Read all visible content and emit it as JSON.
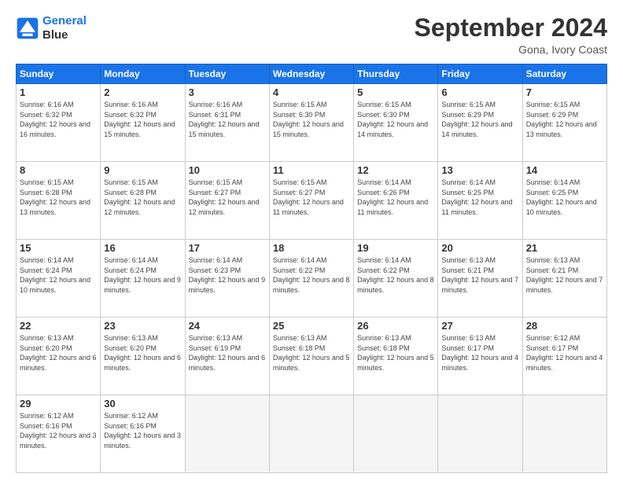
{
  "logo": {
    "line1": "General",
    "line2": "Blue"
  },
  "title": "September 2024",
  "subtitle": "Gona, Ivory Coast",
  "days_header": [
    "Sunday",
    "Monday",
    "Tuesday",
    "Wednesday",
    "Thursday",
    "Friday",
    "Saturday"
  ],
  "weeks": [
    [
      {
        "num": "1",
        "sunrise": "6:16 AM",
        "sunset": "6:32 PM",
        "daylight": "12 hours and 16 minutes."
      },
      {
        "num": "2",
        "sunrise": "6:16 AM",
        "sunset": "6:32 PM",
        "daylight": "12 hours and 15 minutes."
      },
      {
        "num": "3",
        "sunrise": "6:16 AM",
        "sunset": "6:31 PM",
        "daylight": "12 hours and 15 minutes."
      },
      {
        "num": "4",
        "sunrise": "6:15 AM",
        "sunset": "6:30 PM",
        "daylight": "12 hours and 15 minutes."
      },
      {
        "num": "5",
        "sunrise": "6:15 AM",
        "sunset": "6:30 PM",
        "daylight": "12 hours and 14 minutes."
      },
      {
        "num": "6",
        "sunrise": "6:15 AM",
        "sunset": "6:29 PM",
        "daylight": "12 hours and 14 minutes."
      },
      {
        "num": "7",
        "sunrise": "6:15 AM",
        "sunset": "6:29 PM",
        "daylight": "12 hours and 13 minutes."
      }
    ],
    [
      {
        "num": "8",
        "sunrise": "6:15 AM",
        "sunset": "6:28 PM",
        "daylight": "12 hours and 13 minutes."
      },
      {
        "num": "9",
        "sunrise": "6:15 AM",
        "sunset": "6:28 PM",
        "daylight": "12 hours and 12 minutes."
      },
      {
        "num": "10",
        "sunrise": "6:15 AM",
        "sunset": "6:27 PM",
        "daylight": "12 hours and 12 minutes."
      },
      {
        "num": "11",
        "sunrise": "6:15 AM",
        "sunset": "6:27 PM",
        "daylight": "12 hours and 11 minutes."
      },
      {
        "num": "12",
        "sunrise": "6:14 AM",
        "sunset": "6:26 PM",
        "daylight": "12 hours and 11 minutes."
      },
      {
        "num": "13",
        "sunrise": "6:14 AM",
        "sunset": "6:25 PM",
        "daylight": "12 hours and 11 minutes."
      },
      {
        "num": "14",
        "sunrise": "6:14 AM",
        "sunset": "6:25 PM",
        "daylight": "12 hours and 10 minutes."
      }
    ],
    [
      {
        "num": "15",
        "sunrise": "6:14 AM",
        "sunset": "6:24 PM",
        "daylight": "12 hours and 10 minutes."
      },
      {
        "num": "16",
        "sunrise": "6:14 AM",
        "sunset": "6:24 PM",
        "daylight": "12 hours and 9 minutes."
      },
      {
        "num": "17",
        "sunrise": "6:14 AM",
        "sunset": "6:23 PM",
        "daylight": "12 hours and 9 minutes."
      },
      {
        "num": "18",
        "sunrise": "6:14 AM",
        "sunset": "6:22 PM",
        "daylight": "12 hours and 8 minutes."
      },
      {
        "num": "19",
        "sunrise": "6:14 AM",
        "sunset": "6:22 PM",
        "daylight": "12 hours and 8 minutes."
      },
      {
        "num": "20",
        "sunrise": "6:13 AM",
        "sunset": "6:21 PM",
        "daylight": "12 hours and 7 minutes."
      },
      {
        "num": "21",
        "sunrise": "6:13 AM",
        "sunset": "6:21 PM",
        "daylight": "12 hours and 7 minutes."
      }
    ],
    [
      {
        "num": "22",
        "sunrise": "6:13 AM",
        "sunset": "6:20 PM",
        "daylight": "12 hours and 6 minutes."
      },
      {
        "num": "23",
        "sunrise": "6:13 AM",
        "sunset": "6:20 PM",
        "daylight": "12 hours and 6 minutes."
      },
      {
        "num": "24",
        "sunrise": "6:13 AM",
        "sunset": "6:19 PM",
        "daylight": "12 hours and 6 minutes."
      },
      {
        "num": "25",
        "sunrise": "6:13 AM",
        "sunset": "6:18 PM",
        "daylight": "12 hours and 5 minutes."
      },
      {
        "num": "26",
        "sunrise": "6:13 AM",
        "sunset": "6:18 PM",
        "daylight": "12 hours and 5 minutes."
      },
      {
        "num": "27",
        "sunrise": "6:13 AM",
        "sunset": "6:17 PM",
        "daylight": "12 hours and 4 minutes."
      },
      {
        "num": "28",
        "sunrise": "6:12 AM",
        "sunset": "6:17 PM",
        "daylight": "12 hours and 4 minutes."
      }
    ],
    [
      {
        "num": "29",
        "sunrise": "6:12 AM",
        "sunset": "6:16 PM",
        "daylight": "12 hours and 3 minutes."
      },
      {
        "num": "30",
        "sunrise": "6:12 AM",
        "sunset": "6:16 PM",
        "daylight": "12 hours and 3 minutes."
      },
      null,
      null,
      null,
      null,
      null
    ]
  ]
}
